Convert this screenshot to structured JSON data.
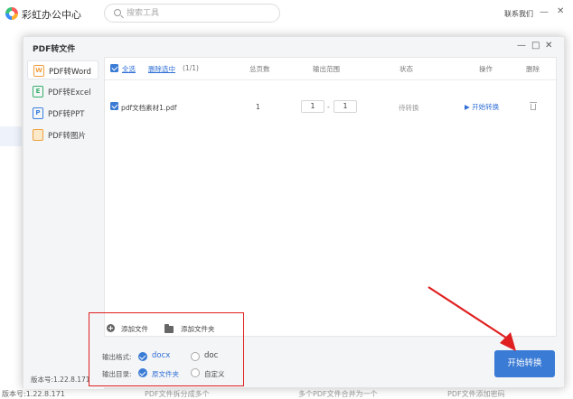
{
  "app": {
    "title": "彩虹办公中心",
    "contact": "联系我们",
    "min_icon": "minus",
    "close_icon": "close"
  },
  "search": {
    "placeholder": "搜索工具"
  },
  "background": {
    "version": "版本号:1.22.8.171",
    "features": [
      "PDF文件拆分成多个",
      "多个PDF文件合并为一个",
      "PDF文件添加密码"
    ]
  },
  "dialog": {
    "title": "PDF转文件",
    "controls": [
      "—",
      "□",
      "✕"
    ],
    "version": "版本号:1.22.8.171",
    "sidebar": [
      {
        "label": "PDF转Word",
        "icon": "W",
        "active": true
      },
      {
        "label": "PDF转Excel",
        "icon": "E",
        "active": false
      },
      {
        "label": "PDF转PPT",
        "icon": "P",
        "active": false
      },
      {
        "label": "PDF转图片",
        "icon": "",
        "active": false
      }
    ],
    "table": {
      "select_all": "全选",
      "delete_selected": "删除选中",
      "count": "(1/1)",
      "headers": {
        "pages": "总页数",
        "range": "输出范围",
        "status": "状态",
        "action": "操作",
        "delete": "删除"
      },
      "rows": [
        {
          "file": "pdf文档素材1.pdf",
          "pages": "1",
          "range_start": "1",
          "range_sep": "-",
          "range_end": "1",
          "status": "待转换",
          "action": "▶ 开始转换"
        }
      ]
    },
    "bottom": {
      "add_file": "添加文件",
      "add_folder": "添加文件夹",
      "format_label": "输出格式:",
      "format_options": [
        "docx",
        "doc"
      ],
      "format_selected": "docx",
      "dir_label": "输出目录:",
      "dir_options": [
        "原文件夹",
        "自定义"
      ],
      "dir_selected": "原文件夹"
    },
    "start_button": "开始转换"
  },
  "colors": {
    "accent": "#3a7bd5",
    "annotation": "#e02020"
  }
}
